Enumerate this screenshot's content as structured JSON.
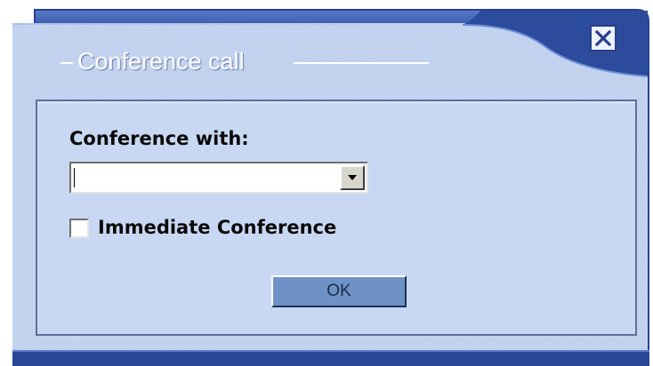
{
  "dialog": {
    "title": "Conference call",
    "close_icon": "close-x-icon"
  },
  "form": {
    "conference_with_label": "Conference with:",
    "conference_with_value": "",
    "dropdown_icon": "chevron-down-icon",
    "immediate_checkbox_label": "Immediate Conference",
    "immediate_checked": false,
    "ok_label": "OK"
  },
  "colors": {
    "frame_blue": "#2f4f9e",
    "panel_blue": "#bcd0ef",
    "inner_panel": "#c9d8f2",
    "button_blue": "#6f92c6"
  }
}
